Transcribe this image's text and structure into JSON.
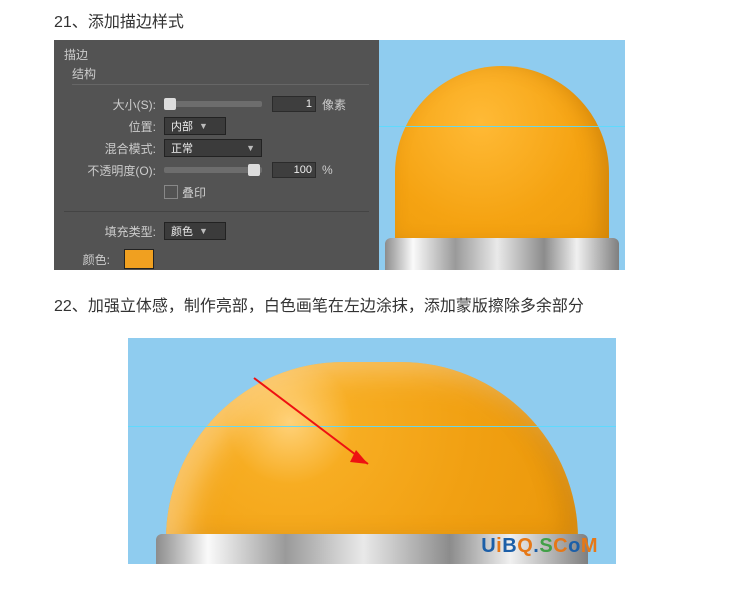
{
  "step21": {
    "number": "21、",
    "title": "添加描边样式"
  },
  "panel": {
    "header": "描边",
    "sub": "结构",
    "size_label": "大小(S):",
    "size_value": "1",
    "size_unit": "像素",
    "position_label": "位置:",
    "position_value": "内部",
    "blend_label": "混合模式:",
    "blend_value": "正常",
    "opacity_label": "不透明度(O):",
    "opacity_value": "100",
    "opacity_unit": "%",
    "overprint_label": "叠印",
    "fill_type_label": "填充类型:",
    "fill_type_value": "颜色",
    "color_label": "颜色:",
    "color": "#f0a020"
  },
  "step22": {
    "number": "22、",
    "title": "加强立体感，制作亮部，白色画笔在左边涂抹，添加蒙版擦除多余部分"
  },
  "watermark": {
    "u": "U",
    "i": "i",
    "b": "B",
    "q": "Q",
    "s": "S",
    "c": "C",
    "o": "o",
    "m": "M",
    "tail": ""
  }
}
